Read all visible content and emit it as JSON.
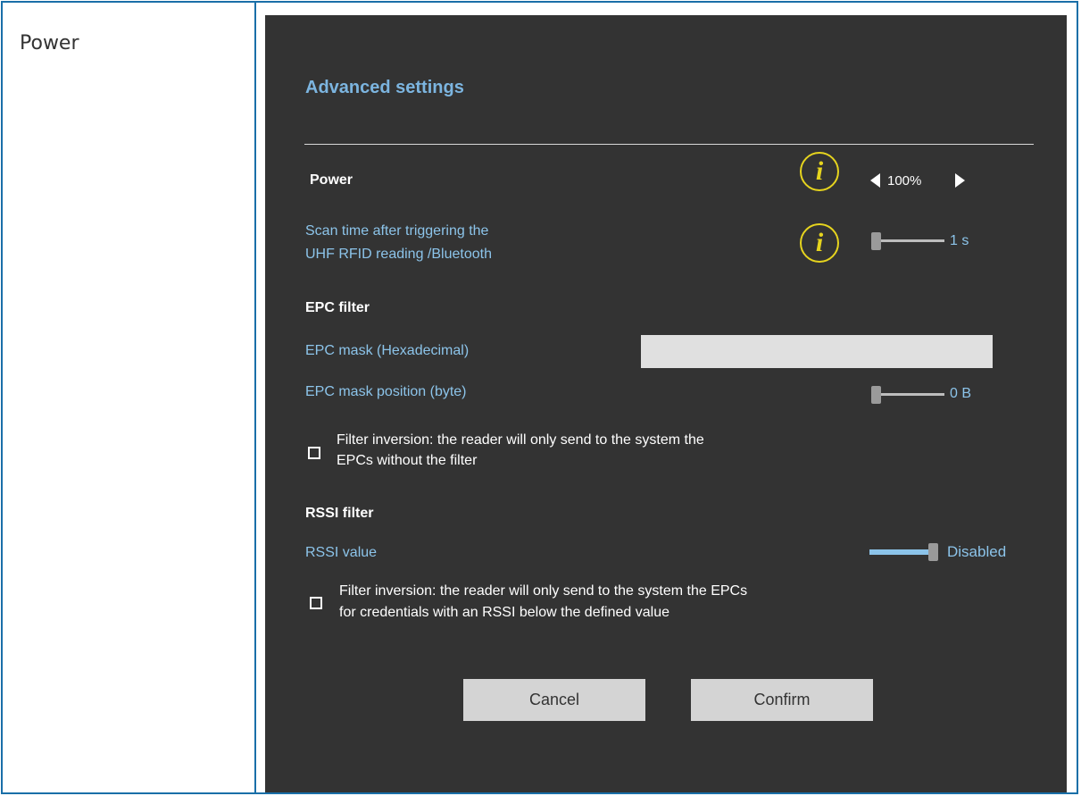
{
  "left_cell": {
    "label": "Power"
  },
  "dialog": {
    "title": "Advanced settings",
    "power": {
      "label": "Power",
      "value": "100%"
    },
    "scan_time": {
      "label_line1": "Scan time after triggering the",
      "label_line2": "UHF RFID reading /Bluetooth",
      "value": "1 s"
    },
    "epc_filter": {
      "heading": "EPC filter",
      "mask_label": "EPC mask (Hexadecimal)",
      "mask_value": "",
      "position_label": "EPC mask position (byte)",
      "position_value": "0 B",
      "inversion_line1": "Filter inversion: the reader will only send to the system the",
      "inversion_line2": "EPCs without the filter",
      "inversion_checked": false
    },
    "rssi_filter": {
      "heading": "RSSI filter",
      "value_label": "RSSI value",
      "value": "Disabled",
      "inversion_line1": "Filter inversion: the reader will only send to the system the EPCs",
      "inversion_line2": "for credentials with an RSSI below the defined value",
      "inversion_checked": false
    },
    "buttons": {
      "cancel": "Cancel",
      "confirm": "Confirm"
    }
  },
  "colors": {
    "panel_bg": "#333333",
    "title_blue": "#7cb5e0",
    "label_blue": "#8cc4ea",
    "info_yellow": "#e6d41e",
    "border_blue": "#1a6fa8"
  },
  "icons": [
    "info-icon",
    "arrow-left-icon",
    "arrow-right-icon"
  ]
}
